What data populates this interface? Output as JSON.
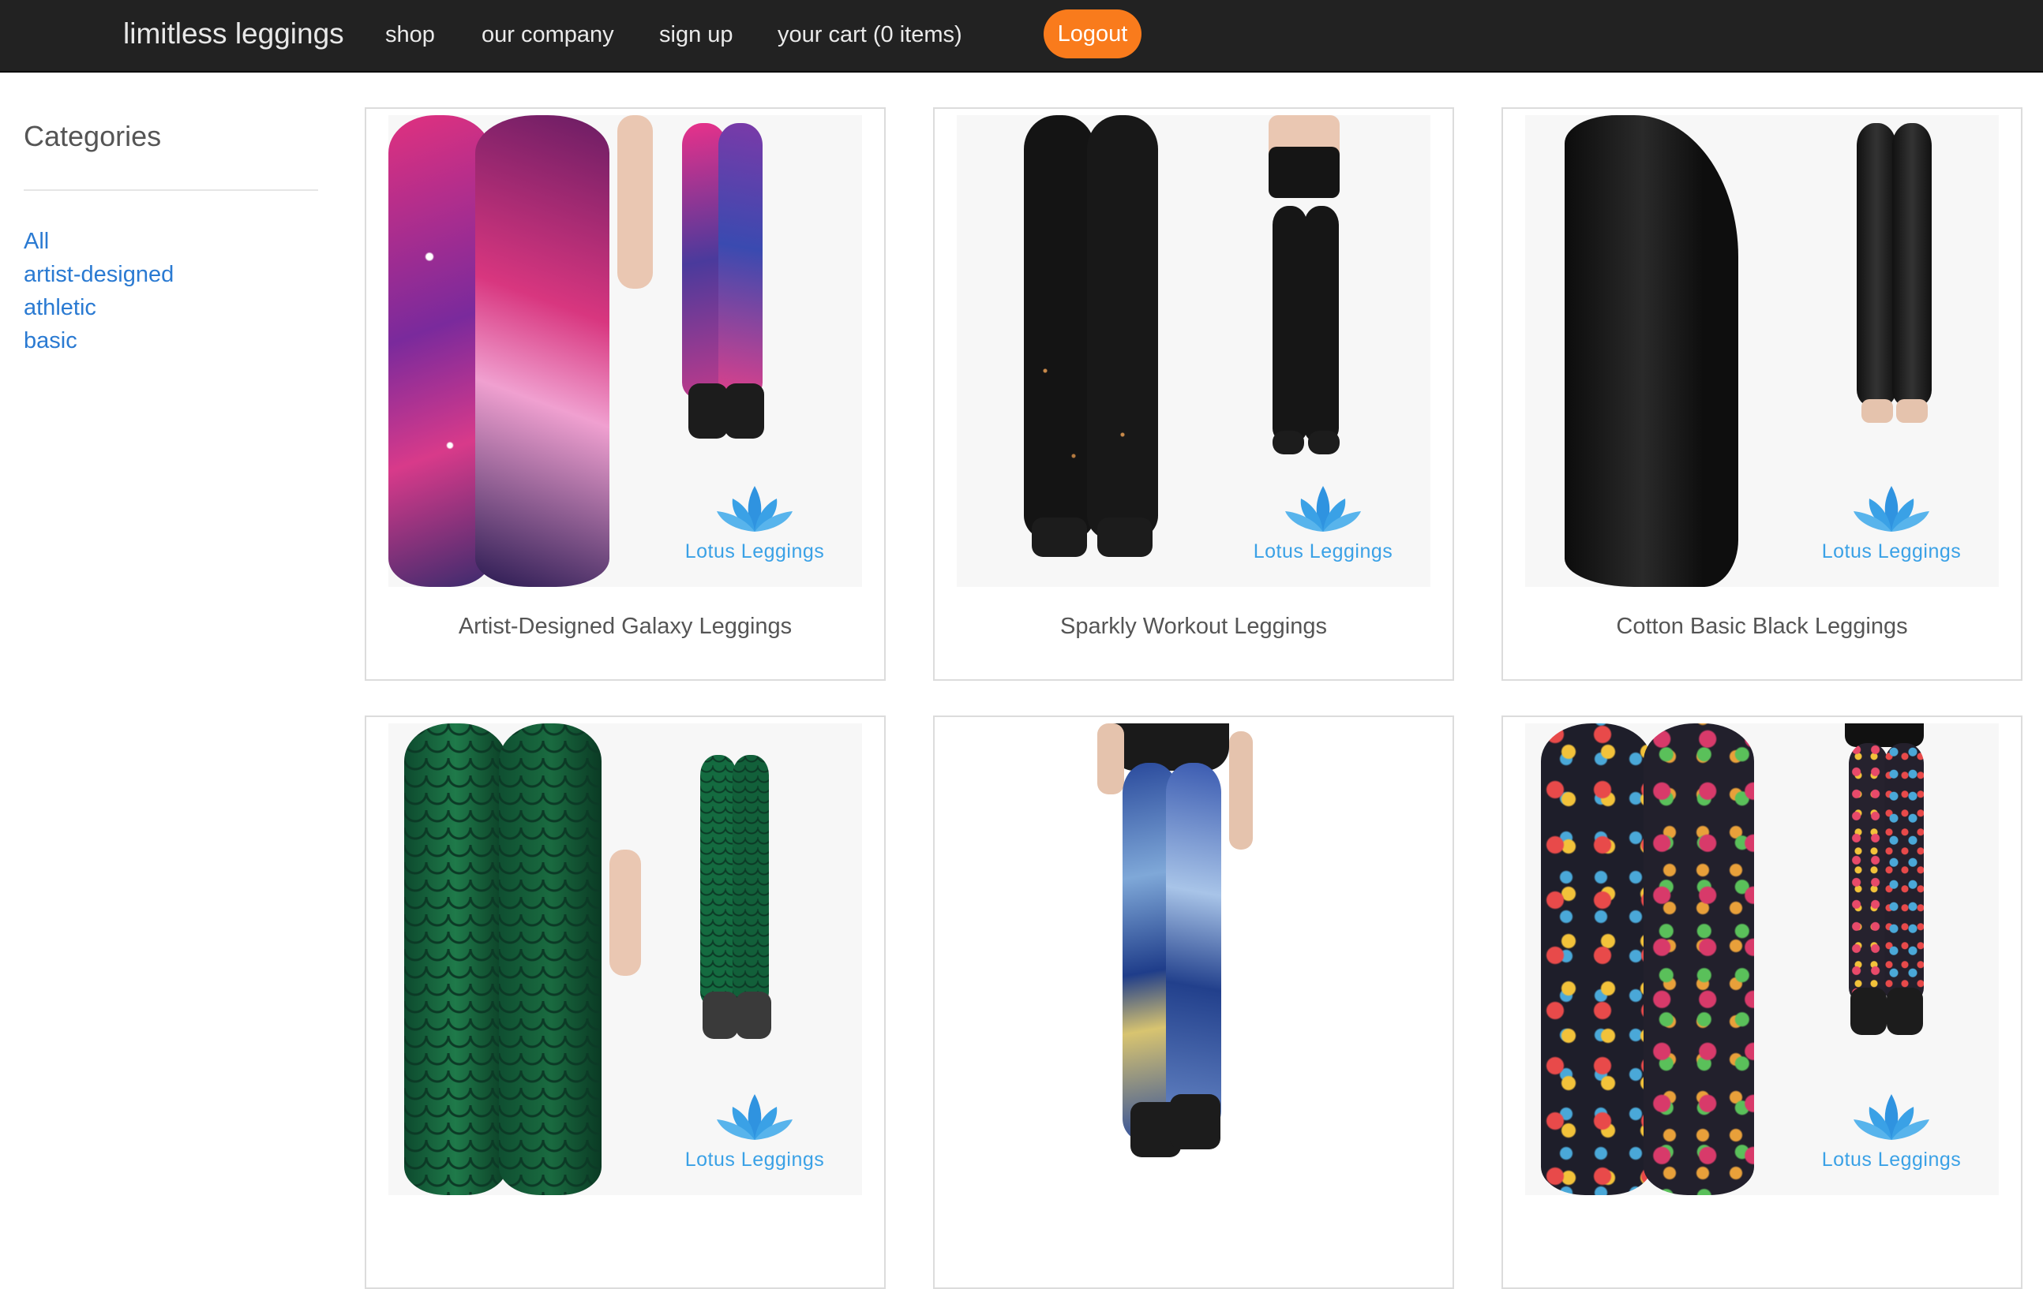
{
  "nav": {
    "brand": "limitless leggings",
    "links": [
      "shop",
      "our company",
      "sign up",
      "your cart (0 items)"
    ],
    "logout_label": "Logout"
  },
  "sidebar": {
    "title": "Categories",
    "items": [
      "All",
      "artist-designed",
      "athletic",
      "basic"
    ]
  },
  "products": [
    {
      "name": "Artist-Designed Galaxy Leggings",
      "logo": "Lotus Leggings",
      "pattern": "galaxy"
    },
    {
      "name": "Sparkly Workout Leggings",
      "logo": "Lotus Leggings",
      "pattern": "sparkly-black"
    },
    {
      "name": "Cotton Basic Black Leggings",
      "logo": "Lotus Leggings",
      "pattern": "solid-black"
    },
    {
      "name": "",
      "logo": "Lotus Leggings",
      "pattern": "green-scales"
    },
    {
      "name": "",
      "logo": "",
      "pattern": "starry-night"
    },
    {
      "name": "",
      "logo": "Lotus Leggings",
      "pattern": "paisley"
    }
  ],
  "colors": {
    "navbar": "#222222",
    "accent": "#f97b1c",
    "link": "#2a7ad2",
    "logo": "#3aa1e6"
  }
}
